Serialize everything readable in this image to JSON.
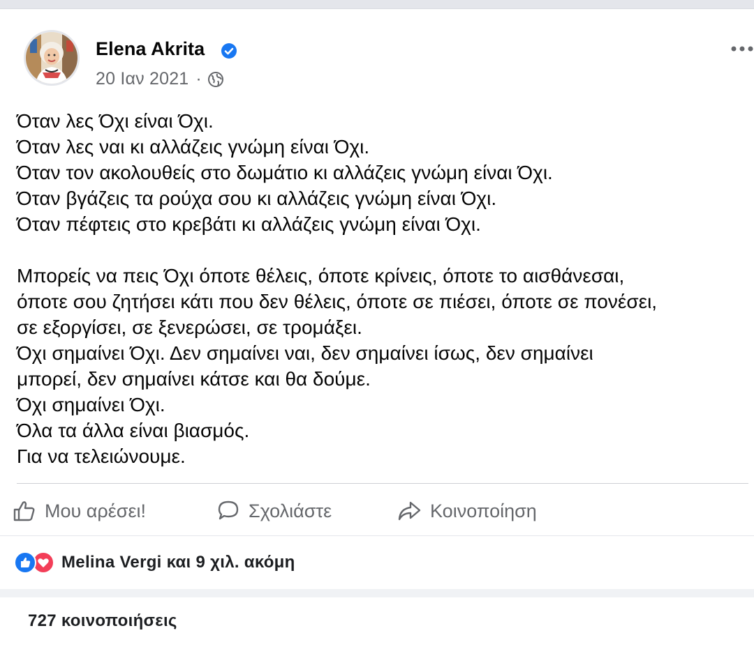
{
  "post": {
    "author": "Elena Akrita",
    "date": "20 Ιαν 2021",
    "meta_separator": "·",
    "lines": [
      "Όταν λες Όχι είναι Όχι.",
      "Όταν λες ναι κι αλλάζεις γνώμη είναι Όχι.",
      "Όταν τον ακολουθείς στο δωμάτιο κι αλλάζεις γνώμη είναι Όχι.",
      "Όταν βγάζεις τα ρούχα σου κι αλλάζεις γνώμη είναι Όχι.",
      "Όταν πέφτεις στο κρεβάτι κι αλλάζεις γνώμη είναι Όχι.",
      "",
      "Μπορείς να πεις Όχι όποτε θέλεις, όποτε κρίνεις, όποτε το αισθάνεσαι,",
      "όποτε σου ζητήσει κάτι που δεν θέλεις, όποτε σε πιέσει, όποτε σε πονέσει,",
      "σε εξοργίσει, σε ξενερώσει, σε τρομάξει.",
      "Όχι σημαίνει Όχι. Δεν σημαίνει ναι, δεν σημαίνει ίσως, δεν σημαίνει",
      "μπορεί, δεν σημαίνει κάτσε και θα δούμε.",
      "Όχι σημαίνει Όχι.",
      "Όλα τα άλλα είναι βιασμός.",
      "Για να τελειώνουμε."
    ]
  },
  "actions": {
    "like": "Μου αρέσει!",
    "comment": "Σχολιάστε",
    "share": "Κοινοποίηση"
  },
  "reactions": {
    "text": "Melina Vergi και 9 χιλ. ακόμη"
  },
  "shares": {
    "text": "727 κοινοποιήσεις"
  },
  "icons": {
    "verified": "verified-badge-icon",
    "audience": "globe-icon",
    "more": "more-options-icon",
    "like": "thumbs-up-icon",
    "comment": "speech-bubble-icon",
    "share": "share-arrow-icon",
    "reaction_like": "like-reaction-icon",
    "reaction_love": "love-reaction-icon"
  },
  "colors": {
    "brand_blue": "#1877f2",
    "love_red": "#f33e58",
    "secondary_text": "#65676b"
  }
}
